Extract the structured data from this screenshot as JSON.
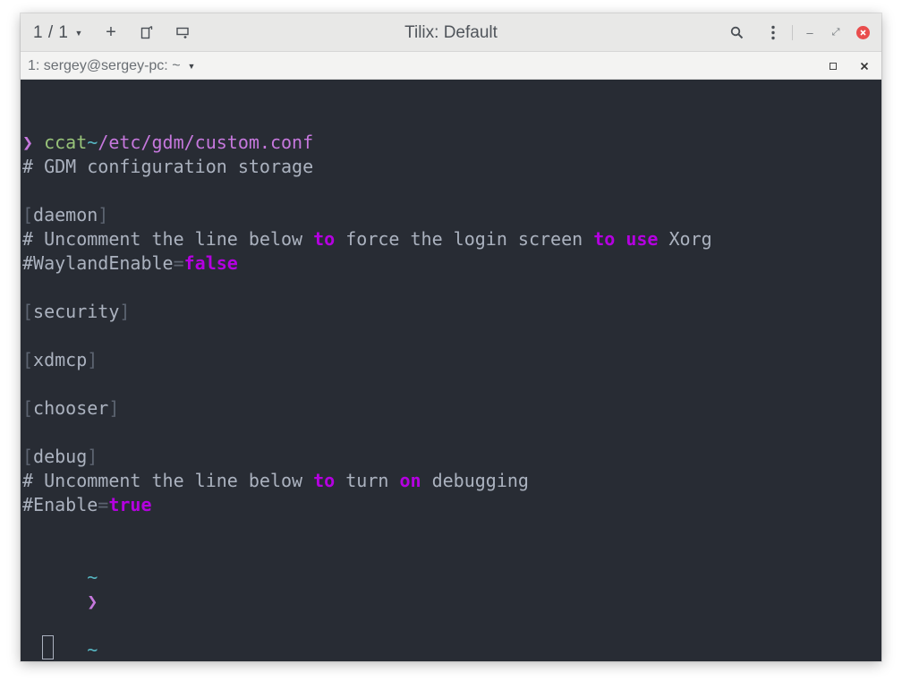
{
  "headerbar": {
    "session_counter": "1 / 1",
    "new_session_label": "+",
    "title": "Tilix: Default"
  },
  "terminal_bar": {
    "title": "1: sergey@sergey-pc: ~"
  },
  "icons": {
    "session_dropdown": "chevron-down-icon",
    "add_session": "plus-icon",
    "split_vertical": "split-vertical-icon",
    "split_horizontal": "split-horizontal-icon",
    "search": "search-icon",
    "menu": "kebab-menu-icon",
    "minimize": "minimize-icon",
    "maximize": "maximize-icon",
    "close": "close-icon",
    "terminal_dropdown": "chevron-down-icon",
    "terminal_maximize": "maximize-square-icon",
    "terminal_close": "close-x-icon"
  },
  "terminal": {
    "prompt_symbol": "❯",
    "tilde": "~",
    "command": "ccat",
    "command_arg": "/etc/gdm/custom.conf",
    "lines": {
      "comment_storage": "# GDM configuration storage",
      "daemon": "daemon",
      "comment1_a": "# Uncomment the line below ",
      "kw_to": "to",
      "comment1_b": " force the login screen ",
      "kw_to2": "to",
      "kw_use": "use",
      "comment1_c": " Xorg",
      "wayland_key": "#WaylandEnable",
      "equals": "=",
      "kw_false": "false",
      "security": "security",
      "xdmcp": "xdmcp",
      "chooser": "chooser",
      "debug": "debug",
      "comment2_a": "# Uncomment the line below ",
      "comment2_b": " turn ",
      "kw_on": "on",
      "comment2_c": " debugging",
      "enable_key": "#Enable",
      "kw_true": "true"
    }
  },
  "colors": {
    "terminal_bg": "#282c34",
    "text": "#abb2bf",
    "tilde": "#56b6c2",
    "prompt": "#c678dd",
    "prompt_error": "#e06c75",
    "command": "#98c379",
    "keyword": "#b400e0",
    "bracket": "#5c6370",
    "close_button": "#e94d4d"
  }
}
